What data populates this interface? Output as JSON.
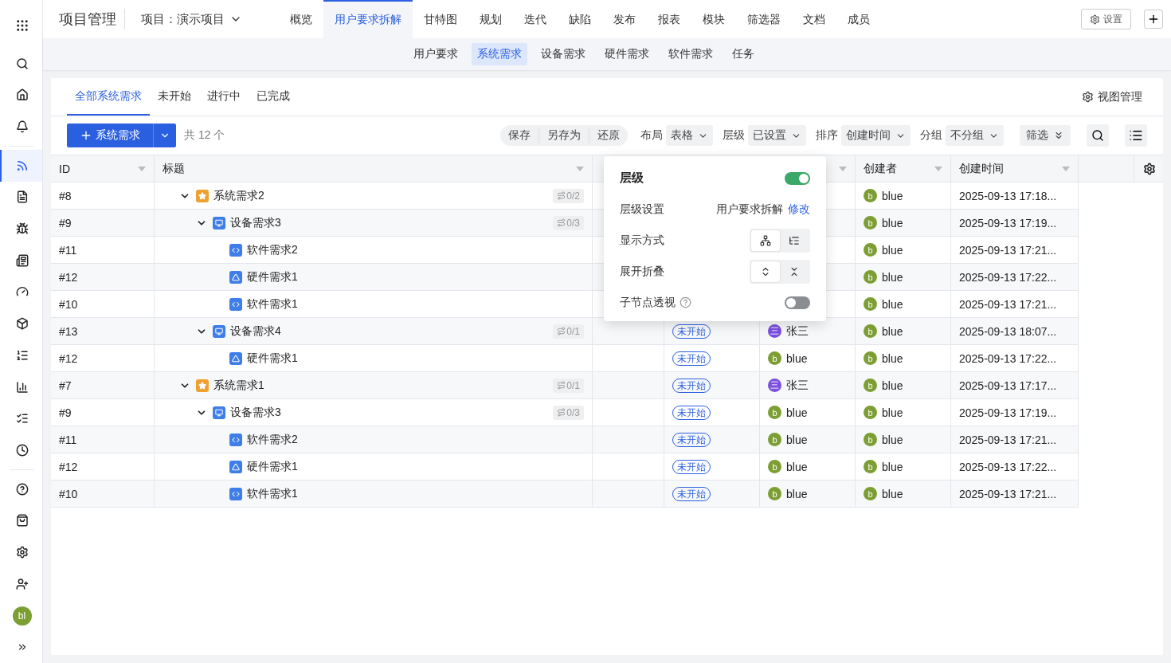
{
  "app": {
    "title": "项目管理",
    "project": "项目：演示项目"
  },
  "nav_tabs": [
    {
      "label": "概览",
      "selected": false
    },
    {
      "label": "用户要求拆解",
      "selected": true
    },
    {
      "label": "甘特图",
      "selected": false
    },
    {
      "label": "规划",
      "selected": false
    },
    {
      "label": "迭代",
      "selected": false
    },
    {
      "label": "缺陷",
      "selected": false
    },
    {
      "label": "发布",
      "selected": false
    },
    {
      "label": "报表",
      "selected": false
    },
    {
      "label": "模块",
      "selected": false
    },
    {
      "label": "筛选器",
      "selected": false
    },
    {
      "label": "文档",
      "selected": false
    },
    {
      "label": "成员",
      "selected": false
    }
  ],
  "settings_button": "设置",
  "sub_tabs": [
    {
      "label": "用户要求",
      "selected": false
    },
    {
      "label": "系统需求",
      "selected": true
    },
    {
      "label": "设备需求",
      "selected": false
    },
    {
      "label": "硬件需求",
      "selected": false
    },
    {
      "label": "软件需求",
      "selected": false
    },
    {
      "label": "任务",
      "selected": false
    }
  ],
  "sidebar": {
    "items": [
      {
        "kind": "search",
        "selected": false
      },
      {
        "kind": "home",
        "selected": false
      },
      {
        "kind": "bell",
        "selected": false
      },
      {
        "kind": "divider"
      },
      {
        "kind": "rss",
        "selected": true
      },
      {
        "kind": "file",
        "selected": false
      },
      {
        "kind": "bug",
        "selected": false
      },
      {
        "kind": "newspaper",
        "selected": false
      },
      {
        "kind": "gauge",
        "selected": false
      },
      {
        "kind": "box",
        "selected": false
      },
      {
        "kind": "steps",
        "selected": false
      },
      {
        "kind": "chart",
        "selected": false
      },
      {
        "kind": "checklist",
        "selected": false
      },
      {
        "kind": "clock",
        "selected": false
      },
      {
        "kind": "divider"
      },
      {
        "kind": "help",
        "selected": false
      },
      {
        "kind": "bag",
        "selected": false
      },
      {
        "kind": "settings",
        "selected": false
      },
      {
        "kind": "user-plus",
        "selected": false
      }
    ],
    "avatar": "bl"
  },
  "view_tabs": [
    {
      "label": "全部系统需求",
      "selected": true
    },
    {
      "label": "未开始",
      "selected": false
    },
    {
      "label": "进行中",
      "selected": false
    },
    {
      "label": "已完成",
      "selected": false
    }
  ],
  "view_manage": "视图管理",
  "toolbar": {
    "add_button": "系统需求",
    "count": "共 12 个",
    "view_actions": [
      "保存",
      "另存为",
      "还原"
    ],
    "selects": [
      {
        "label": "布局",
        "value": "表格"
      },
      {
        "label": "层级",
        "value": "已设置"
      },
      {
        "label": "排序",
        "value": "创建时间"
      },
      {
        "label": "分组",
        "value": "不分组"
      }
    ],
    "filter": "筛选"
  },
  "table": {
    "columns": [
      "ID",
      "标题",
      "创建者",
      "创建时间"
    ],
    "rows": [
      {
        "id": "#8",
        "title": "系统需求2",
        "kind": "system",
        "expanded": true,
        "progress": "0/2",
        "creator": {
          "initial": "b",
          "name": "blue",
          "color": "#7c9e32"
        },
        "created": "2025-09-13 17:18...",
        "children": [
          {
            "id": "#9",
            "title": "设备需求3",
            "kind": "device",
            "expanded": true,
            "progress": "0/3",
            "creator": {
              "initial": "b",
              "name": "blue",
              "color": "#7c9e32"
            },
            "created": "2025-09-13 17:19...",
            "children": [
              {
                "id": "#11",
                "title": "软件需求2",
                "kind": "software",
                "creator": {
                  "initial": "b",
                  "name": "blue",
                  "color": "#7c9e32"
                },
                "created": "2025-09-13 17:21..."
              },
              {
                "id": "#12",
                "title": "硬件需求1",
                "kind": "hardware",
                "creator": {
                  "initial": "b",
                  "name": "blue",
                  "color": "#7c9e32"
                },
                "created": "2025-09-13 17:22..."
              },
              {
                "id": "#10",
                "title": "软件需求1",
                "kind": "software",
                "creator": {
                  "initial": "b",
                  "name": "blue",
                  "color": "#7c9e32"
                },
                "created": "2025-09-13 17:21..."
              }
            ]
          },
          {
            "id": "#13",
            "title": "设备需求4",
            "kind": "device",
            "expanded": true,
            "progress": "0/1",
            "status": "未开始",
            "assignee": {
              "initial": "三",
              "name": "张三",
              "color": "#7b4fe0"
            },
            "creator": {
              "initial": "b",
              "name": "blue",
              "color": "#7c9e32"
            },
            "created": "2025-09-13 18:07...",
            "children": [
              {
                "id": "#12",
                "title": "硬件需求1",
                "kind": "hardware",
                "status": "未开始",
                "assignee": {
                  "initial": "b",
                  "name": "blue",
                  "color": "#7c9e32"
                },
                "creator": {
                  "initial": "b",
                  "name": "blue",
                  "color": "#7c9e32"
                },
                "created": "2025-09-13 17:22..."
              }
            ]
          }
        ]
      },
      {
        "id": "#7",
        "title": "系统需求1",
        "kind": "system",
        "expanded": true,
        "progress": "0/1",
        "status": "未开始",
        "assignee": {
          "initial": "三",
          "name": "张三",
          "color": "#7b4fe0"
        },
        "creator": {
          "initial": "b",
          "name": "blue",
          "color": "#7c9e32"
        },
        "created": "2025-09-13 17:17...",
        "children": [
          {
            "id": "#9",
            "title": "设备需求3",
            "kind": "device",
            "expanded": true,
            "progress": "0/3",
            "status": "未开始",
            "assignee": {
              "initial": "b",
              "name": "blue",
              "color": "#7c9e32"
            },
            "creator": {
              "initial": "b",
              "name": "blue",
              "color": "#7c9e32"
            },
            "created": "2025-09-13 17:19...",
            "children": [
              {
                "id": "#11",
                "title": "软件需求2",
                "kind": "software",
                "status": "未开始",
                "assignee": {
                  "initial": "b",
                  "name": "blue",
                  "color": "#7c9e32"
                },
                "creator": {
                  "initial": "b",
                  "name": "blue",
                  "color": "#7c9e32"
                },
                "created": "2025-09-13 17:21..."
              },
              {
                "id": "#12",
                "title": "硬件需求1",
                "kind": "hardware",
                "status": "未开始",
                "assignee": {
                  "initial": "b",
                  "name": "blue",
                  "color": "#7c9e32"
                },
                "creator": {
                  "initial": "b",
                  "name": "blue",
                  "color": "#7c9e32"
                },
                "created": "2025-09-13 17:22..."
              },
              {
                "id": "#10",
                "title": "软件需求1",
                "kind": "software",
                "status": "未开始",
                "assignee": {
                  "initial": "b",
                  "name": "blue",
                  "color": "#7c9e32"
                },
                "creator": {
                  "initial": "b",
                  "name": "blue",
                  "color": "#7c9e32"
                },
                "created": "2025-09-13 17:21..."
              }
            ]
          }
        ]
      }
    ]
  },
  "hierarchy_popover": {
    "title": "层级",
    "on": true,
    "setting_label": "层级设置",
    "setting_value": "用户要求拆解",
    "edit_link": "修改",
    "display_label": "显示方式",
    "display_options": [
      {
        "kind": "tree",
        "selected": true
      },
      {
        "kind": "list",
        "selected": false
      }
    ],
    "fold_label": "展开折叠",
    "fold_options": [
      {
        "kind": "expand",
        "selected": true
      },
      {
        "kind": "collapse",
        "selected": false
      }
    ],
    "child_view_label": "子节点透视",
    "child_view_on": false
  }
}
